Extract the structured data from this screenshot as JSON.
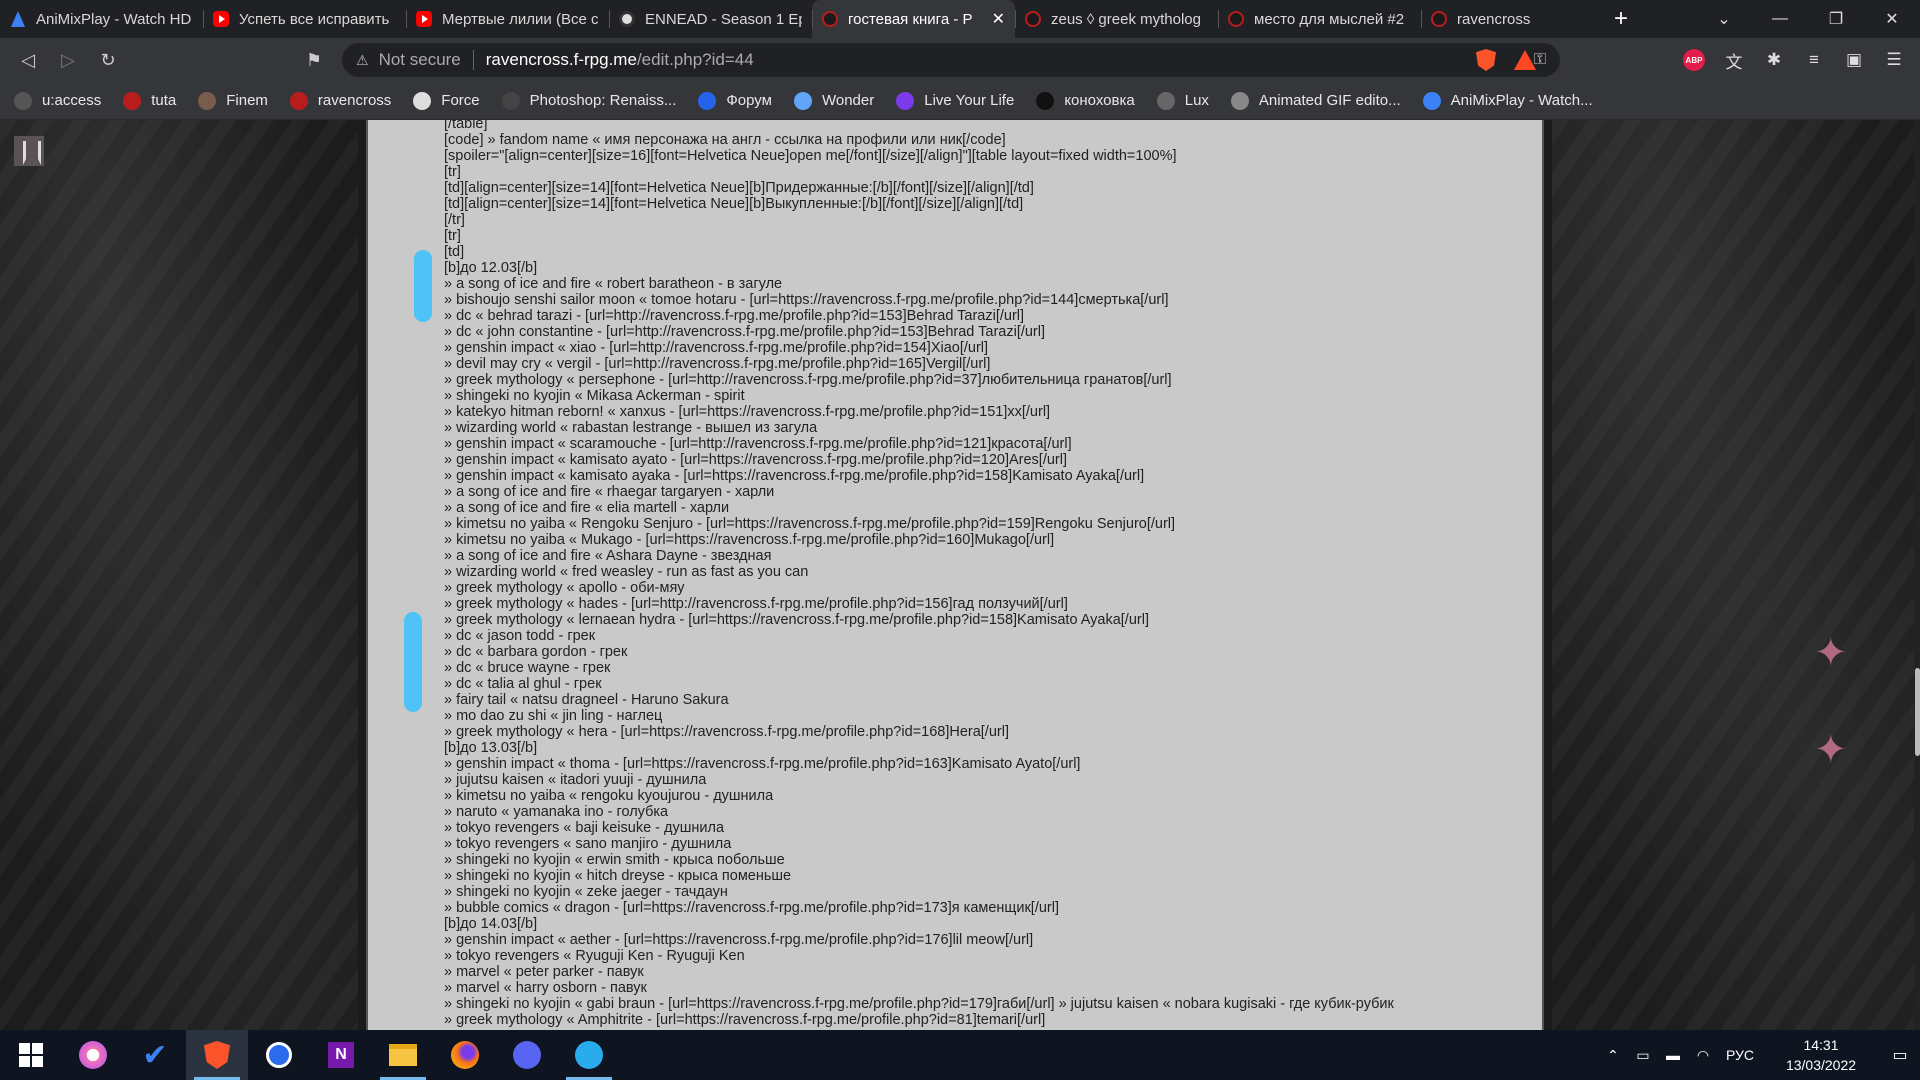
{
  "tabs": [
    {
      "title": "AniMixPlay - Watch HD",
      "icon": "ami"
    },
    {
      "title": "Успеть все исправить",
      "icon": "yt"
    },
    {
      "title": "Мертвые лилии (Все с",
      "icon": "yt"
    },
    {
      "title": "ENNEAD - Season 1 Ep",
      "icon": "ennead"
    },
    {
      "title": "гостевая книга - P",
      "icon": "raven",
      "active": true
    },
    {
      "title": "zeus ◊ greek mytholog",
      "icon": "raven"
    },
    {
      "title": "место для мыслей #2",
      "icon": "raven"
    },
    {
      "title": "ravencross",
      "icon": "raven"
    }
  ],
  "address": {
    "warning": "Not secure",
    "host": "ravencross.f-rpg.me",
    "path": "/edit.php?id=44"
  },
  "bookmarks": [
    {
      "label": "u:access",
      "color": "#555"
    },
    {
      "label": "tuta",
      "color": "#b91c1c"
    },
    {
      "label": "Finem",
      "color": "#7a5c4a"
    },
    {
      "label": "ravencross",
      "color": "#b91c1c"
    },
    {
      "label": "Force",
      "color": "#ddd"
    },
    {
      "label": "Photoshop: Renaiss...",
      "color": "#444"
    },
    {
      "label": "Форум",
      "color": "#2563eb"
    },
    {
      "label": "Wonder",
      "color": "#60a5fa"
    },
    {
      "label": "Live Your Life",
      "color": "#7c3aed"
    },
    {
      "label": "коноховка",
      "color": "#111"
    },
    {
      "label": "Lux",
      "color": "#666"
    },
    {
      "label": "Animated GIF edito...",
      "color": "#888"
    },
    {
      "label": "AniMixPlay - Watch...",
      "color": "#3b82f6"
    }
  ],
  "editor_lines": [
    "[/table]",
    "[code] » fandom name « имя персонажа на англ - ссылка на профили или ник[/code]",
    "[spoiler=\"[align=center][size=16][font=Helvetica Neue]open me[/font][/size][/align]\"][table layout=fixed width=100%]",
    "[tr]",
    "[td][align=center][size=14][font=Helvetica Neue][b]Придержанные:[/b][/font][/size][/align][/td]",
    "[td][align=center][size=14][font=Helvetica Neue][b]Выкупленные:[/b][/font][/size][/align][/td]",
    "[/tr]",
    "[tr]",
    "[td]",
    "[b]до 12.03[/b]",
    "» a song of ice and fire « robert baratheon - в загуле",
    "» bishoujo senshi sailor moon « tomoe hotaru - [url=https://ravencross.f-rpg.me/profile.php?id=144]смертька[/url]",
    "» dc « behrad tarazi - [url=http://ravencross.f-rpg.me/profile.php?id=153]Behrad Tarazi[/url]",
    "» dc « john constantine - [url=http://ravencross.f-rpg.me/profile.php?id=153]Behrad Tarazi[/url]",
    "» genshin impact « xiao - [url=http://ravencross.f-rpg.me/profile.php?id=154]Xiao[/url]",
    "» devil may cry « vergil - [url=http://ravencross.f-rpg.me/profile.php?id=165]Vergil[/url]",
    "» greek mythology « persephone - [url=http://ravencross.f-rpg.me/profile.php?id=37]любительница гранатов[/url]",
    "» shingeki no kyojin « Mikasa Ackerman - spirit",
    "» katekyo hitman reborn! « xanxus - [url=https://ravencross.f-rpg.me/profile.php?id=151]xx[/url]",
    "» wizarding world « rabastan lestrange - вышел из загула",
    "» genshin impact « scaramouche - [url=http://ravencross.f-rpg.me/profile.php?id=121]красота[/url]",
    "» genshin impact « kamisato ayato - [url=https://ravencross.f-rpg.me/profile.php?id=120]Ares[/url]",
    "» genshin impact « kamisato ayaka - [url=https://ravencross.f-rpg.me/profile.php?id=158]Kamisato Ayaka[/url]",
    "» a song of ice and fire « rhaegar targaryen - харли",
    "» a song of ice and fire « elia martell - харли",
    "» kimetsu no yaiba « Rengoku Senjuro - [url=https://ravencross.f-rpg.me/profile.php?id=159]Rengoku Senjuro[/url]",
    "» kimetsu no yaiba « Mukago - [url=https://ravencross.f-rpg.me/profile.php?id=160]Mukago[/url]",
    "» a song of ice and fire « Ashara Dayne - звездная",
    "» wizarding world « fred weasley - run as fast as you can",
    "» greek mythology « apollo - оби-мяу",
    "» greek mythology « hades - [url=http://ravencross.f-rpg.me/profile.php?id=156]гад ползучий[/url]",
    "» greek mythology « lernaean hydra - [url=https://ravencross.f-rpg.me/profile.php?id=158]Kamisato Ayaka[/url]",
    "» dc « jason todd - грек",
    "» dc « barbara gordon - грек",
    "» dc « bruce wayne - грек",
    "» dc « talia al ghul - грек",
    "» fairy tail « natsu dragneel - Haruno Sakura",
    "» mo dao zu shi « jin ling - наглец",
    "» greek mythology « hera - [url=https://ravencross.f-rpg.me/profile.php?id=168]Hera[/url]",
    "[b]до 13.03[/b]",
    "» genshin impact « thoma - [url=https://ravencross.f-rpg.me/profile.php?id=163]Kamisato Ayato[/url]",
    "» jujutsu kaisen « itadori yuuji - душнила",
    "» kimetsu no yaiba « rengoku kyoujurou - душнила",
    "» naruto « yamanaka ino - голубка",
    "» tokyo revengers « baji keisuke - душнила",
    "» tokyo revengers « sano manjiro - душнила",
    "» shingeki no kyojin « erwin smith - крыса побольше",
    "» shingeki no kyojin « hitch dreyse - крыса поменьше",
    "» shingeki no kyojin « zeke jaeger - тачдаун",
    "» bubble comics « dragon - [url=https://ravencross.f-rpg.me/profile.php?id=173]я каменщик[/url]",
    "[b]до 14.03[/b]",
    "» genshin impact « aether - [url=https://ravencross.f-rpg.me/profile.php?id=176]lil meow[/url]",
    "» tokyo revengers « Ryuguji Ken - Ryuguji Ken",
    "» marvel « peter parker - павук",
    "» marvel « harry osborn - павук",
    "» shingeki no kyojin « gabi braun - [url=https://ravencross.f-rpg.me/profile.php?id=179]габи[/url] » jujutsu kaisen « nobara kugisaki - где кубик-рубик",
    "» greek mythology « Amphitrite - [url=https://ravencross.f-rpg.me/profile.php?id=81]temari[/url]"
  ],
  "tray": {
    "lang": "РУС",
    "time": "14:31",
    "date": "13/03/2022"
  },
  "icons": {
    "back": "◁",
    "forward": "▷",
    "reload": "↻",
    "bookmark": "🔖",
    "key": "⚿",
    "new_tab": "+",
    "minimize": "—",
    "restore": "❐",
    "close": "✕",
    "extensions": "✱",
    "notif": "▭"
  }
}
